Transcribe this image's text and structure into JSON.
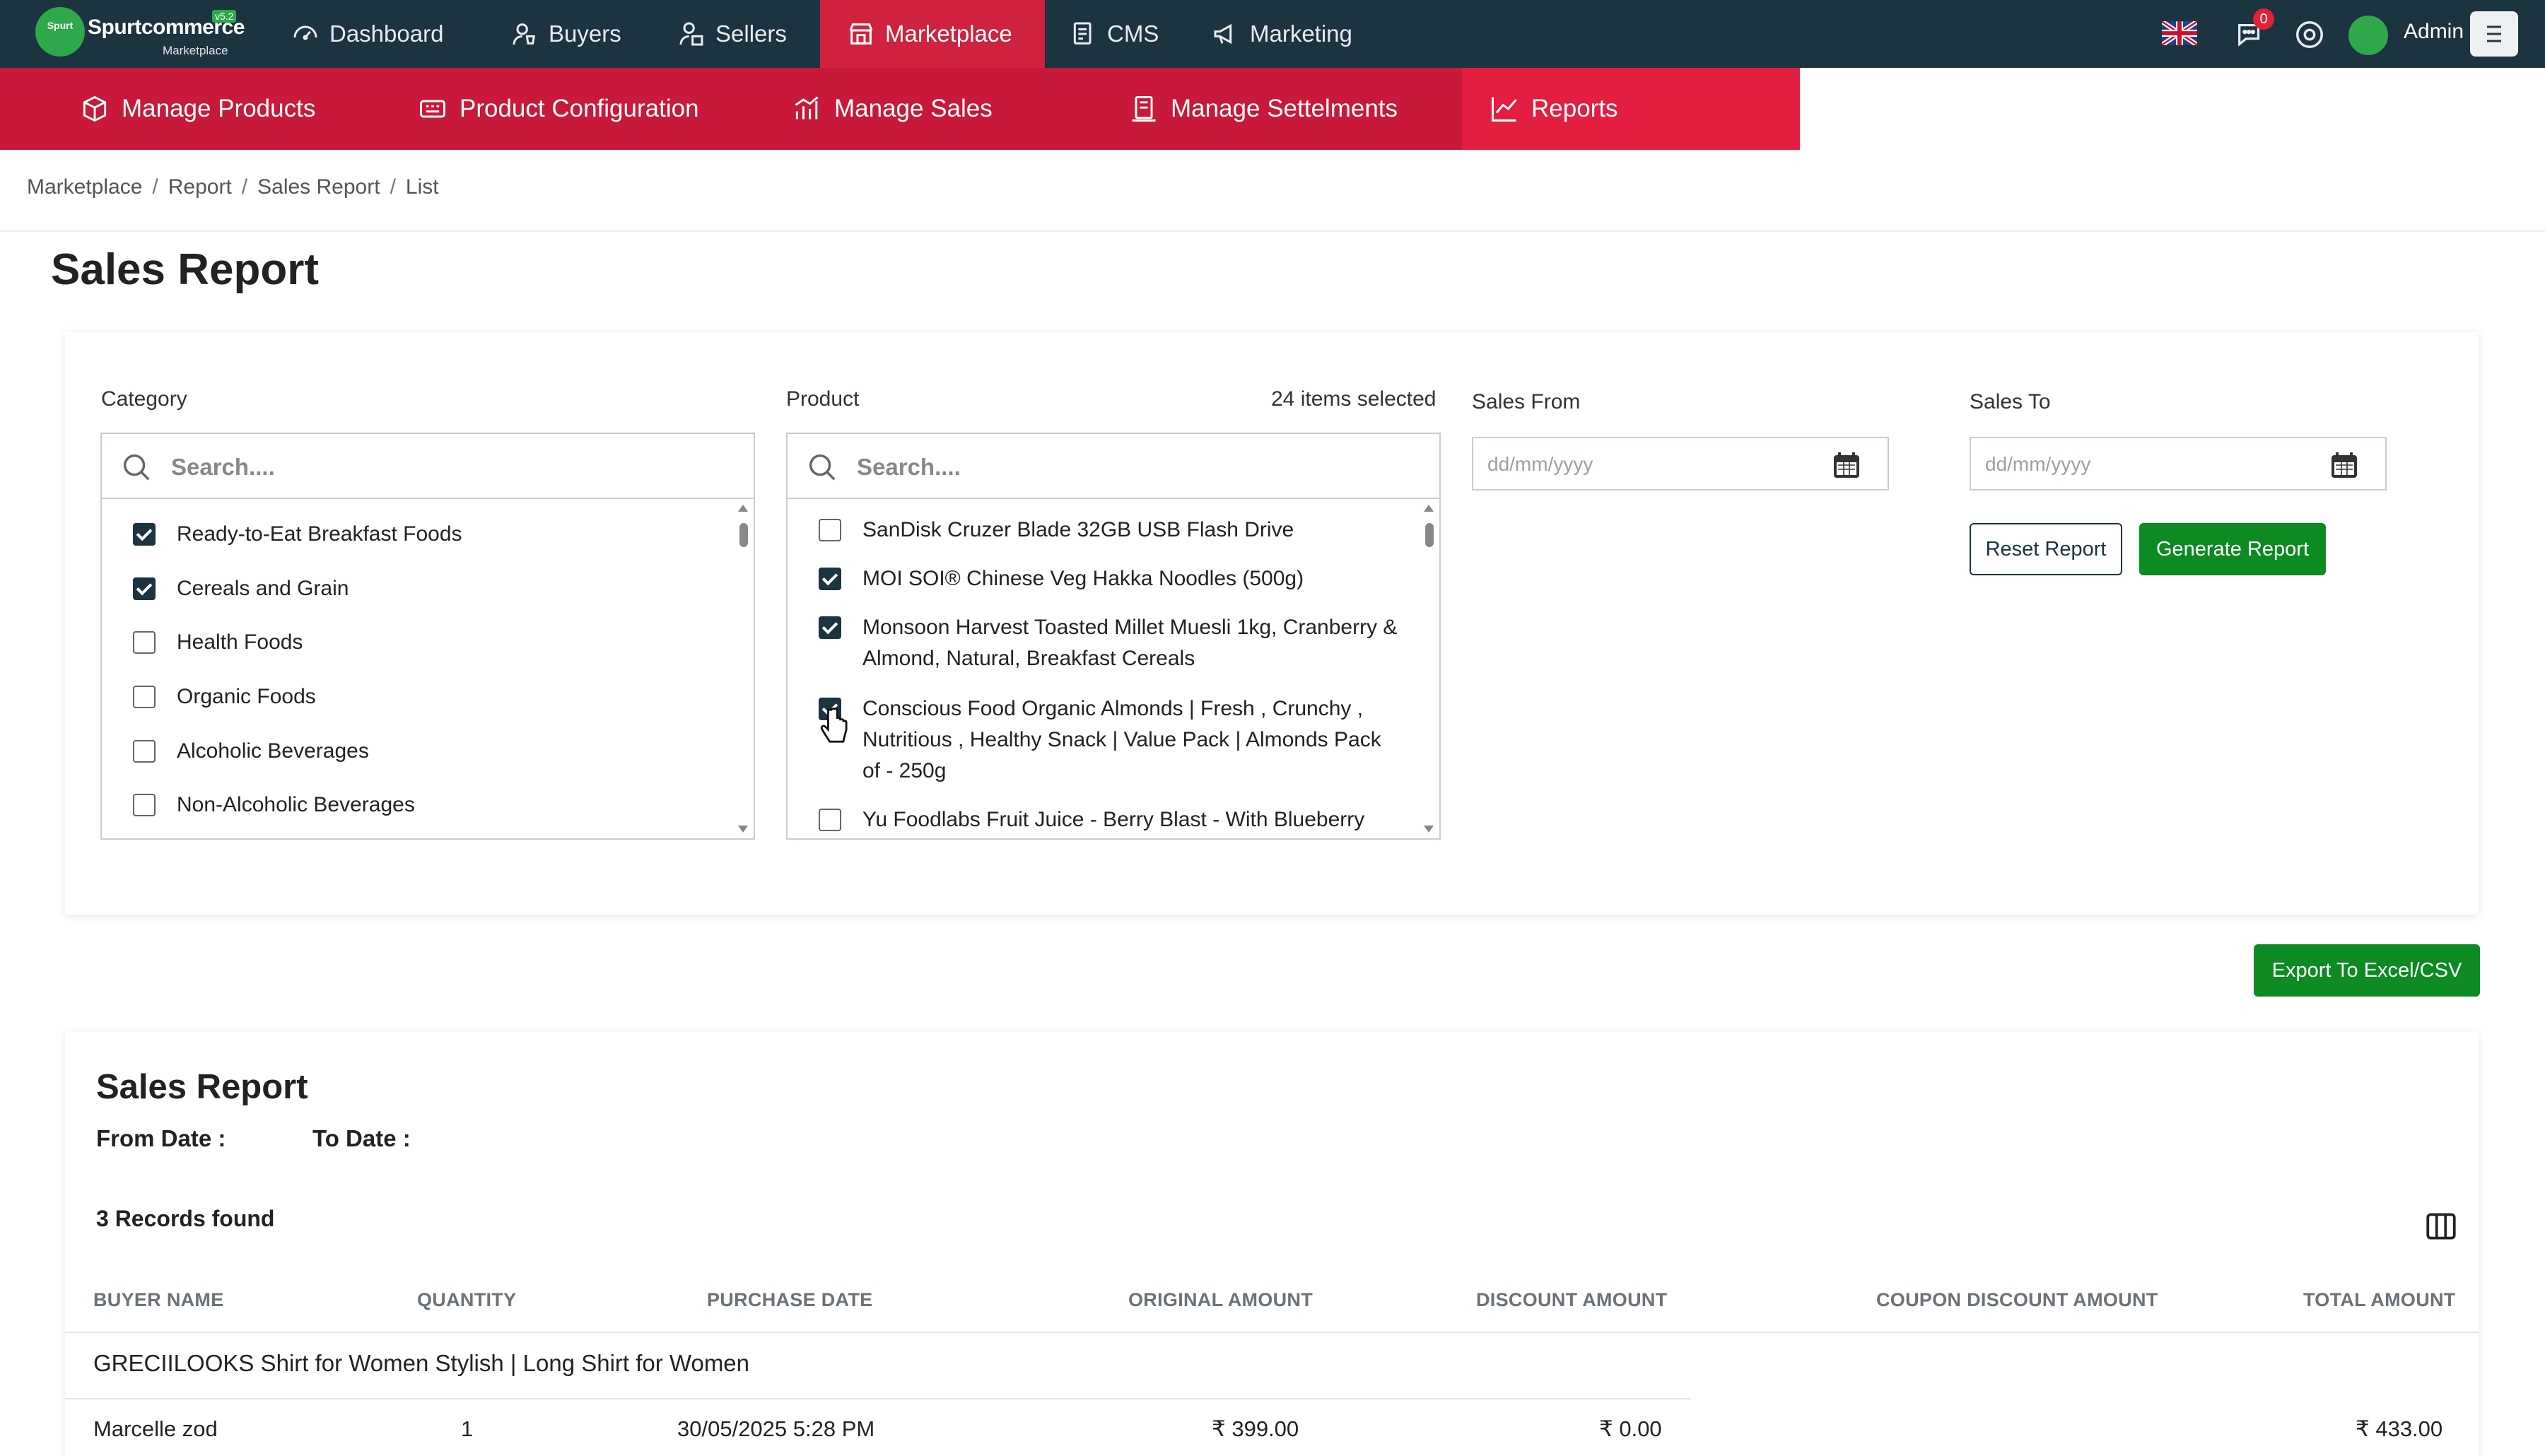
{
  "brand": {
    "name": "Spurtcommerce",
    "subtitle": "Marketplace",
    "version": "v5.2",
    "badge": "Spurt"
  },
  "topnav": {
    "items": [
      {
        "label": "Dashboard",
        "icon": "dashboard-icon"
      },
      {
        "label": "Buyers",
        "icon": "buyers-icon"
      },
      {
        "label": "Sellers",
        "icon": "sellers-icon"
      },
      {
        "label": "Marketplace",
        "icon": "marketplace-icon",
        "active": true
      },
      {
        "label": "CMS",
        "icon": "cms-icon"
      },
      {
        "label": "Marketing",
        "icon": "megaphone-icon"
      }
    ],
    "notification_count": "0",
    "user": "Admin"
  },
  "subnav": {
    "items": [
      {
        "label": "Manage Products",
        "icon": "box-icon"
      },
      {
        "label": "Product Configuration",
        "icon": "config-icon"
      },
      {
        "label": "Manage Sales",
        "icon": "bar-chart-icon"
      },
      {
        "label": "Manage Settelments",
        "icon": "settlement-icon"
      },
      {
        "label": "Reports",
        "icon": "line-chart-icon",
        "active": true
      }
    ]
  },
  "breadcrumb": [
    "Marketplace",
    "Report",
    "Sales Report",
    "List"
  ],
  "page_title": "Sales Report",
  "filters": {
    "category": {
      "label": "Category",
      "search_placeholder": "Search....",
      "items": [
        {
          "label": "Ready-to-Eat Breakfast Foods",
          "checked": true
        },
        {
          "label": "Cereals and Grain",
          "checked": true
        },
        {
          "label": "Health Foods",
          "checked": false
        },
        {
          "label": "Organic Foods",
          "checked": false
        },
        {
          "label": "Alcoholic Beverages",
          "checked": false
        },
        {
          "label": "Non-Alcoholic Beverages",
          "checked": false
        }
      ]
    },
    "product": {
      "label": "Product",
      "selected_count": "24 items selected",
      "search_placeholder": "Search....",
      "items": [
        {
          "lines": [
            "SanDisk Cruzer Blade 32GB USB Flash Drive"
          ],
          "checked": false
        },
        {
          "lines": [
            "MOI SOI® Chinese Veg Hakka Noodles (500g)"
          ],
          "checked": true
        },
        {
          "lines": [
            "Monsoon Harvest Toasted Millet Muesli 1kg, Cranberry &",
            "Almond, Natural, Breakfast Cereals"
          ],
          "checked": true
        },
        {
          "lines": [
            "Conscious Food Organic Almonds | Fresh , Crunchy ,",
            "Nutritious , Healthy Snack | Value Pack | Almonds Pack",
            "of - 250g"
          ],
          "checked": true
        },
        {
          "lines": [
            "Yu Foodlabs Fruit Juice - Berry Blast - With Blueberry"
          ],
          "checked": false
        }
      ]
    },
    "sales_from": {
      "label": "Sales From",
      "placeholder": "dd/mm/yyyy"
    },
    "sales_to": {
      "label": "Sales To",
      "placeholder": "dd/mm/yyyy"
    },
    "reset_label": "Reset Report",
    "generate_label": "Generate Report"
  },
  "export_label": "Export To Excel/CSV",
  "report": {
    "title": "Sales Report",
    "from_label": "From Date :",
    "to_label": "To Date :",
    "records": "3 Records found",
    "columns": [
      "BUYER NAME",
      "QUANTITY",
      "PURCHASE DATE",
      "ORIGINAL AMOUNT",
      "DISCOUNT AMOUNT",
      "COUPON DISCOUNT AMOUNT",
      "TOTAL AMOUNT"
    ],
    "group": "GRECIILOOKS Shirt for Women Stylish | Long Shirt for Women",
    "first_row": [
      "Marcelle zod",
      "1",
      "30/05/2025 5:28 PM",
      "₹ 399.00",
      "₹ 0.00",
      "",
      "₹ 433.00"
    ]
  },
  "colors": {
    "topbar": "#1c3340",
    "subnav": "#c8193a",
    "active": "#d0213f",
    "green": "#0d8a22"
  }
}
